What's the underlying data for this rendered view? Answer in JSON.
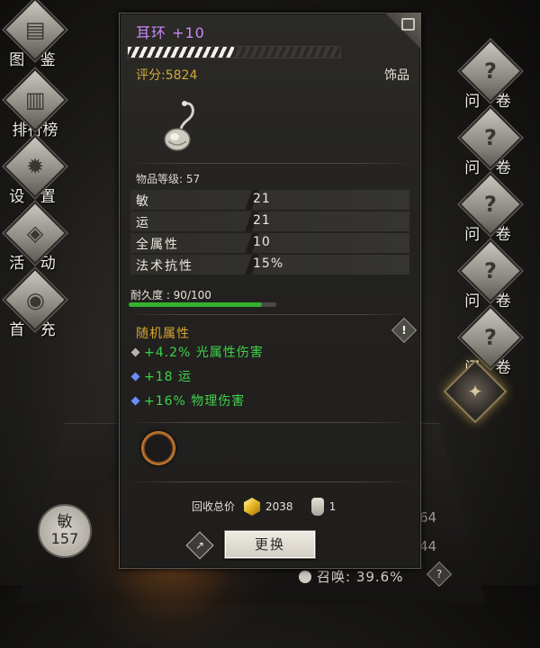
{
  "left_menu": [
    {
      "label": "图 鉴",
      "icon": "book-icon"
    },
    {
      "label": "排行榜",
      "icon": "ranking-bars-icon"
    },
    {
      "label": "设 置",
      "icon": "gear-icon"
    },
    {
      "label": "活 动",
      "icon": "event-chest-icon"
    },
    {
      "label": "首 充",
      "icon": "first-recharge-icon"
    }
  ],
  "right_menu": [
    {
      "label": "问 卷",
      "icon": "question-icon"
    },
    {
      "label": "问 卷",
      "icon": "question-icon"
    },
    {
      "label": "问 卷",
      "icon": "question-icon"
    },
    {
      "label": "问 卷",
      "icon": "question-icon"
    },
    {
      "label": "问 卷",
      "icon": "question-icon"
    }
  ],
  "stat_badge": {
    "name": "敏",
    "value": "157"
  },
  "bg_numbers": [
    "64",
    "44"
  ],
  "summon": {
    "text": "召唤: 39.6%"
  },
  "help_symbol": "?",
  "item": {
    "title": "耳环 +10",
    "stars_fill_fraction": 0.5,
    "score": "评分:5824",
    "category": "饰品",
    "level": "物品等级: 57",
    "stats": [
      {
        "name": "敏",
        "value": "21"
      },
      {
        "name": "运",
        "value": "21"
      },
      {
        "name": "全属性",
        "value": "10"
      },
      {
        "name": "法术抗性",
        "value": "15%"
      }
    ],
    "durability_label": "耐久度 : 90/100",
    "durability_fraction": 0.9,
    "random_title": "随机属性",
    "warn_symbol": "!",
    "affixes": [
      {
        "text": "+4.2% 光属性伤害",
        "color": "#3fd34a",
        "gem_color": "#b8b3a8"
      },
      {
        "text": "+18 运",
        "color": "#3fd34a",
        "gem_color": "#6b8cff"
      },
      {
        "text": "+16% 物理伤害",
        "color": "#3fd34a",
        "gem_color": "#6b8cff"
      }
    ],
    "recycle_label": "回收总价",
    "gold_value": "2038",
    "bottle_value": "1",
    "replace_label": "更换"
  }
}
